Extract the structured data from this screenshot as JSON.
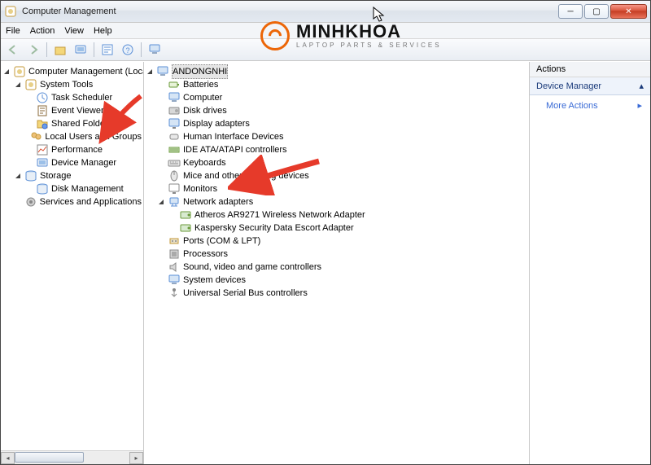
{
  "window": {
    "title": "Computer Management"
  },
  "menu": {
    "file": "File",
    "action": "Action",
    "view": "View",
    "help": "Help"
  },
  "actions": {
    "header": "Actions",
    "section": "Device Manager",
    "more": "More Actions"
  },
  "left_tree": {
    "root": "Computer Management (Local)",
    "items": [
      {
        "label": "System Tools",
        "expanded": true,
        "children": [
          {
            "label": "Task Scheduler"
          },
          {
            "label": "Event Viewer"
          },
          {
            "label": "Shared Folders"
          },
          {
            "label": "Local Users and Groups"
          },
          {
            "label": "Performance"
          },
          {
            "label": "Device Manager"
          }
        ]
      },
      {
        "label": "Storage",
        "expanded": true,
        "children": [
          {
            "label": "Disk Management"
          }
        ]
      },
      {
        "label": "Services and Applications",
        "expanded": false
      }
    ]
  },
  "dev_tree": {
    "root": "ANDONGNHI",
    "items": [
      {
        "label": "Batteries"
      },
      {
        "label": "Computer"
      },
      {
        "label": "Disk drives"
      },
      {
        "label": "Display adapters"
      },
      {
        "label": "Human Interface Devices"
      },
      {
        "label": "IDE ATA/ATAPI controllers"
      },
      {
        "label": "Keyboards"
      },
      {
        "label": "Mice and other pointing devices"
      },
      {
        "label": "Monitors"
      },
      {
        "label": "Network adapters",
        "expanded": true,
        "children": [
          {
            "label": "Atheros AR9271 Wireless Network Adapter"
          },
          {
            "label": "Kaspersky Security Data Escort Adapter"
          }
        ]
      },
      {
        "label": "Ports (COM & LPT)"
      },
      {
        "label": "Processors"
      },
      {
        "label": "Sound, video and game controllers"
      },
      {
        "label": "System devices"
      },
      {
        "label": "Universal Serial Bus controllers"
      }
    ]
  },
  "logo": {
    "name": "MINHKHOA",
    "tag": "LAPTOP PARTS & SERVICES"
  }
}
